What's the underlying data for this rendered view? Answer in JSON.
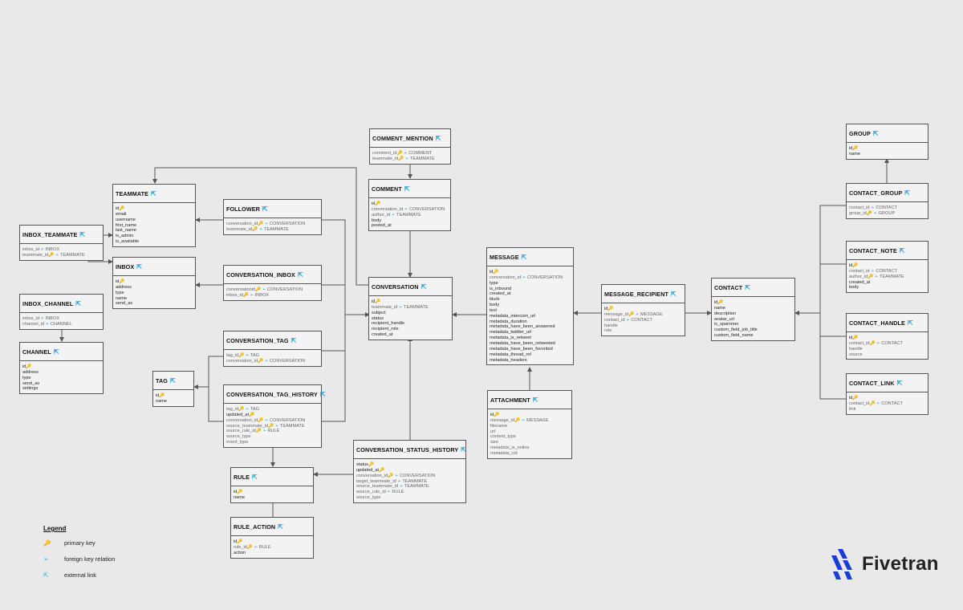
{
  "symbols": {
    "pk": "🔑",
    "fk": "➢",
    "link": "⇱"
  },
  "tables": [
    {
      "id": "comment_mention",
      "name": "COMMENT_MENTION",
      "fields": [
        {
          "n": "comment_id",
          "pk": true,
          "ref": "COMMENT"
        },
        {
          "n": "teammate_id",
          "pk": true,
          "ref": "TEAMMATE"
        }
      ]
    },
    {
      "id": "comment",
      "name": "COMMENT",
      "fields": [
        {
          "n": "id",
          "pk": true
        },
        {
          "n": "conversation_id",
          "ref": "CONVERSATION"
        },
        {
          "n": "author_id",
          "ref": "TEAMMATE"
        },
        {
          "n": "body"
        },
        {
          "n": "posted_at"
        }
      ]
    },
    {
      "id": "teammate",
      "name": "TEAMMATE",
      "fields": [
        {
          "n": "id",
          "pk": true
        },
        {
          "n": "email"
        },
        {
          "n": "username"
        },
        {
          "n": "first_name"
        },
        {
          "n": "last_name"
        },
        {
          "n": "is_admin"
        },
        {
          "n": "is_available"
        }
      ]
    },
    {
      "id": "follower",
      "name": "FOLLOWER",
      "fields": [
        {
          "n": "conversation_id",
          "pk": true,
          "ref": "CONVERSATION"
        },
        {
          "n": "teammate_id",
          "pk": true,
          "ref": "TEAMMATE"
        }
      ]
    },
    {
      "id": "inbox_teammate",
      "name": "INBOX_TEAMMATE",
      "fields": [
        {
          "n": "inbox_id",
          "ref": "INBOX"
        },
        {
          "n": "teammate_id",
          "pk": true,
          "ref": "TEAMMATE"
        }
      ]
    },
    {
      "id": "inbox",
      "name": "INBOX",
      "fields": [
        {
          "n": "id",
          "pk": true
        },
        {
          "n": "address"
        },
        {
          "n": "type"
        },
        {
          "n": "name"
        },
        {
          "n": "send_as"
        }
      ]
    },
    {
      "id": "conversation_inbox",
      "name": "CONVERSATION_INBOX",
      "fields": [
        {
          "n": "conversationid",
          "pk": true,
          "ref": "CONVERSATION"
        },
        {
          "n": "inbox_id",
          "pk": true,
          "ref": "INBOX"
        }
      ]
    },
    {
      "id": "inbox_channel",
      "name": "INBOX_CHANNEL",
      "fields": [
        {
          "n": "inbox_id",
          "ref": "INBOX"
        },
        {
          "n": "channel_id",
          "ref": "CHANNEL"
        }
      ]
    },
    {
      "id": "channel",
      "name": "CHANNEL",
      "fields": [
        {
          "n": "id",
          "pk": true
        },
        {
          "n": "address"
        },
        {
          "n": "type"
        },
        {
          "n": "send_as"
        },
        {
          "n": "settings"
        }
      ]
    },
    {
      "id": "conversation",
      "name": "CONVERSATION",
      "fields": [
        {
          "n": "id",
          "pk": true
        },
        {
          "n": "teammate_id",
          "ref": "TEAMMATE"
        },
        {
          "n": "subject"
        },
        {
          "n": "status"
        },
        {
          "n": "recipient_handle"
        },
        {
          "n": "recipient_role"
        },
        {
          "n": "created_at"
        }
      ]
    },
    {
      "id": "conversation_tag",
      "name": "CONVERSATION_TAG",
      "fields": [
        {
          "n": "tag_id",
          "pk": true,
          "ref": "TAG"
        },
        {
          "n": "conversation_id",
          "pk": true,
          "ref": "CONVERSATION"
        }
      ]
    },
    {
      "id": "tag",
      "name": "TAG",
      "fields": [
        {
          "n": "id",
          "pk": true
        },
        {
          "n": "name"
        }
      ]
    },
    {
      "id": "conversation_tag_history",
      "name": "CONVERSATION_TAG_HISTORY",
      "fields": [
        {
          "n": "tag_id",
          "pk": true,
          "ref": "TAG"
        },
        {
          "n": "updated_at",
          "pk": true
        },
        {
          "n": "conversation_id",
          "pk": true,
          "ref": "CONVERSATION"
        },
        {
          "n": "source_teammate_id",
          "pk": true,
          "ref": "TEAMMATE"
        },
        {
          "n": "source_rule_id",
          "pk": true,
          "ref": "RULE"
        },
        {
          "n": "source_type",
          "ln": true
        },
        {
          "n": "event_type",
          "ln": true
        }
      ]
    },
    {
      "id": "rule",
      "name": "RULE",
      "fields": [
        {
          "n": "id",
          "pk": true
        },
        {
          "n": "name"
        }
      ]
    },
    {
      "id": "rule_action",
      "name": "RULE_ACTION",
      "fields": [
        {
          "n": "id",
          "pk": true
        },
        {
          "n": "rule_id",
          "pk": true,
          "ref": "RULE"
        },
        {
          "n": "action"
        }
      ]
    },
    {
      "id": "conversation_status_history",
      "name": "CONVERSATION_STATUS_HISTORY",
      "fields": [
        {
          "n": "status",
          "pk": true
        },
        {
          "n": "updated_at",
          "pk": true
        },
        {
          "n": "conversation_id",
          "pk": true,
          "ref": "CONVERSATION"
        },
        {
          "n": "target_teammate_id",
          "ref": "TEAMMATE"
        },
        {
          "n": "source_teammate_id",
          "ref": "TEAMMATE"
        },
        {
          "n": "source_rule_id",
          "ref": "RULE"
        },
        {
          "n": "source_type",
          "ln": true
        }
      ]
    },
    {
      "id": "message",
      "name": "MESSAGE",
      "fields": [
        {
          "n": "id",
          "pk": true
        },
        {
          "n": "conversation_id",
          "ref": "CONVERSATION"
        },
        {
          "n": "type"
        },
        {
          "n": "is_inbound"
        },
        {
          "n": "created_at"
        },
        {
          "n": "blurb"
        },
        {
          "n": "body"
        },
        {
          "n": "text"
        },
        {
          "n": "metadata_intercom_url"
        },
        {
          "n": "metadata_duration"
        },
        {
          "n": "metadata_have_been_answered"
        },
        {
          "n": "metadata_twittter_url"
        },
        {
          "n": "metadata_is_retweet"
        },
        {
          "n": "metadata_have_been_retweeted"
        },
        {
          "n": "metadata_have_been_fovorited"
        },
        {
          "n": "metadata_thread_ref"
        },
        {
          "n": "metadata_headers"
        }
      ]
    },
    {
      "id": "attachment",
      "name": "ATTACHMENT",
      "fields": [
        {
          "n": "id",
          "pk": true
        },
        {
          "n": "message_id",
          "pk": true,
          "ref": "MESSAGE"
        },
        {
          "n": "filename",
          "ln": true
        },
        {
          "n": "url",
          "ln": true
        },
        {
          "n": "content_type",
          "ln": true
        },
        {
          "n": "size",
          "ln": true
        },
        {
          "n": "metadata_is_online",
          "ln": true
        },
        {
          "n": "metadata_cid",
          "ln": true
        }
      ]
    },
    {
      "id": "message_recipient",
      "name": "MESSAGE_RECIPIENT",
      "fields": [
        {
          "n": "id",
          "pk": true
        },
        {
          "n": "message_id",
          "pk": true,
          "ref": "MESSAGE"
        },
        {
          "n": "contact_id",
          "ref": "CONTACT"
        },
        {
          "n": "handle",
          "ln": true
        },
        {
          "n": "role",
          "ln": true
        }
      ]
    },
    {
      "id": "contact",
      "name": "CONTACT",
      "fields": [
        {
          "n": "id",
          "pk": true
        },
        {
          "n": "name"
        },
        {
          "n": "description"
        },
        {
          "n": "avatar_url"
        },
        {
          "n": "is_spammer"
        },
        {
          "n": "custom_field_job_title"
        },
        {
          "n": "custom_field_name"
        }
      ]
    },
    {
      "id": "group",
      "name": "GROUP",
      "fields": [
        {
          "n": "id",
          "pk": true
        },
        {
          "n": "name"
        }
      ]
    },
    {
      "id": "contact_group",
      "name": "CONTACT_GROUP",
      "fields": [
        {
          "n": "contact_id",
          "ref": "CONTACT"
        },
        {
          "n": "group_id",
          "pk": true,
          "ref": "GROUP"
        }
      ]
    },
    {
      "id": "contact_note",
      "name": "CONTACT_NOTE",
      "fields": [
        {
          "n": "id",
          "pk": true
        },
        {
          "n": "contact_id",
          "ref": "CONTACT"
        },
        {
          "n": "author_id",
          "pk": true,
          "ref": "TEAMMATE"
        },
        {
          "n": "created_at"
        },
        {
          "n": "body"
        }
      ]
    },
    {
      "id": "contact_handle",
      "name": "CONTACT_HANDLE",
      "fields": [
        {
          "n": "id",
          "pk": true
        },
        {
          "n": "contact_id",
          "pk": true,
          "ref": "CONTACT"
        },
        {
          "n": "handle",
          "ln": true
        },
        {
          "n": "source",
          "ln": true
        }
      ]
    },
    {
      "id": "contact_link",
      "name": "CONTACT_LINK",
      "fields": [
        {
          "n": "id",
          "pk": true
        },
        {
          "n": "contact_id",
          "pk": true,
          "ref": "CONTACT"
        },
        {
          "n": "link",
          "ln": true
        }
      ]
    }
  ],
  "legend": {
    "title": "Legend",
    "primary_key": "primary key",
    "foreign_key": "foreign key relation",
    "external_link": "external link"
  },
  "brand": {
    "name": "Fivetran"
  }
}
